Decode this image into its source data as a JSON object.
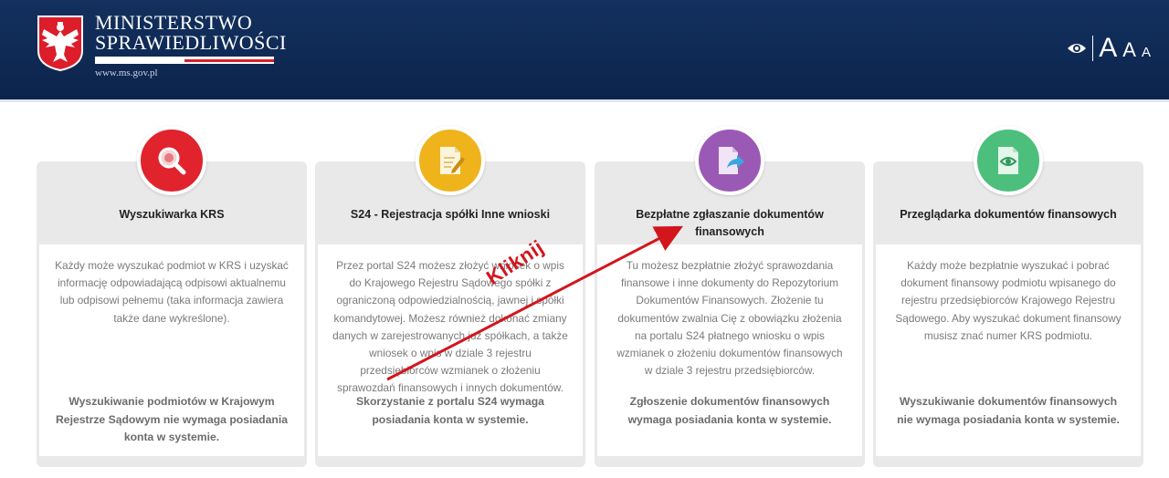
{
  "header": {
    "logo_line1": "MINISTERSTWO",
    "logo_line2": "SPRAWIEDLIWOŚCI",
    "logo_url": "www.ms.gov.pl",
    "accessibility": {
      "size_large": "A",
      "size_medium": "A",
      "size_small": "A"
    }
  },
  "colors": {
    "header_bg": "#13305e",
    "card1": "#e0232c",
    "card2": "#efb41c",
    "card3": "#9b59b6",
    "card4": "#4cbf7c",
    "annotation": "#d3151c"
  },
  "cards": [
    {
      "icon": "magnifier-icon",
      "title": "Wyszukiwarka KRS",
      "description": "Każdy może wyszukać podmiot w KRS i uzyskać informację odpowiadającą odpisowi aktualnemu lub odpisowi pełnemu (taka informacja zawiera także dane wykreślone).",
      "note": "Wyszukiwanie podmiotów w Krajowym Rejestrze Sądowym nie wymaga posiadania konta w systemie."
    },
    {
      "icon": "document-edit-icon",
      "title": "S24 - Rejestracja spółki Inne wnioski",
      "description": "Przez portal S24 możesz złożyć wniosek o wpis do Krajowego Rejestru Sądowego spółki z ograniczoną odpowiedzialnością, jawnej i spółki komandytowej. Możesz również dokonać zmiany danych w zarejestrowanych już spółkach, a także wniosek o wpis w dziale 3 rejestru przedsiębiorców wzmianek o złożeniu sprawozdań finansowych i innych dokumentów.",
      "note": "Skorzystanie z portalu S24 wymaga posiadania konta w systemie."
    },
    {
      "icon": "document-send-icon",
      "title": "Bezpłatne zgłaszanie dokumentów finansowych",
      "description": "Tu możesz bezpłatnie złożyć sprawozdania finansowe i inne dokumenty do Repozytorium Dokumentów Finansowych. Złożenie tu dokumentów zwalnia Cię z obowiązku złożenia na portalu S24 płatnego wniosku o wpis wzmianek o złożeniu dokumentów finansowych w dziale 3 rejestru przedsiębiorców.",
      "note": "Zgłoszenie dokumentów finansowych wymaga posiadania konta w systemie."
    },
    {
      "icon": "document-view-icon",
      "title": "Przeglądarka dokumentów finansowych",
      "description": "Każdy może bezpłatnie wyszukać i pobrać dokument finansowy podmiotu wpisanego do rejestru przedsiębiorców Krajowego Rejestru Sądowego. Aby wyszukać dokument finansowy musisz znać numer KRS podmiotu.",
      "note": "Wyszukiwanie dokumentów finansowych nie wymaga posiadania konta w systemie."
    }
  ],
  "annotation": {
    "label": "Kliknij"
  }
}
